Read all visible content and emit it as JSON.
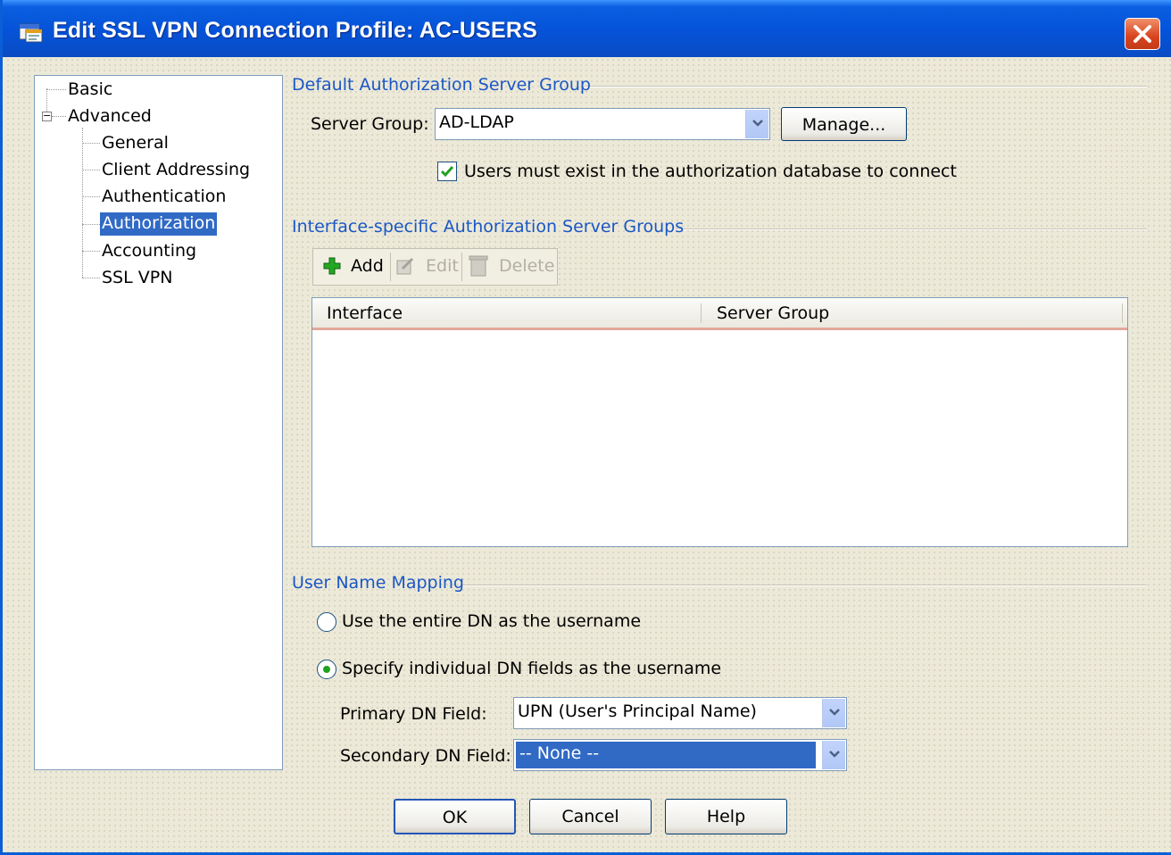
{
  "window": {
    "title": "Edit SSL VPN Connection Profile: AC-USERS"
  },
  "tree": {
    "basic": "Basic",
    "advanced": "Advanced",
    "expander": "−",
    "children": [
      "General",
      "Client Addressing",
      "Authentication",
      "Authorization",
      "Accounting",
      "SSL VPN"
    ],
    "selected": "Authorization"
  },
  "default_auth": {
    "section_title": "Default Authorization Server Group",
    "server_group_label": "Server Group:",
    "server_group_value": "AD-LDAP",
    "manage_label": "Manage...",
    "must_exist_label": "Users must exist in the authorization database to connect",
    "must_exist_checked": true
  },
  "interface_auth": {
    "section_title": "Interface-specific Authorization Server Groups",
    "toolbar": {
      "add": "Add",
      "edit": "Edit",
      "delete": "Delete"
    },
    "columns": [
      "Interface",
      "Server Group"
    ],
    "rows": []
  },
  "user_name_mapping": {
    "section_title": "User Name Mapping",
    "option_entire_dn": "Use the entire DN as the username",
    "option_individual": "Specify individual DN fields as the username",
    "selected_option": "individual",
    "primary_label": "Primary DN Field:",
    "primary_value": "UPN (User's Principal Name)",
    "secondary_label": "Secondary DN Field:",
    "secondary_value": "-- None --"
  },
  "buttons": {
    "ok": "OK",
    "cancel": "Cancel",
    "help": "Help"
  },
  "colors": {
    "titlebar": "#0552d8",
    "section_title": "#1a57c6",
    "selection": "#316ac5",
    "close_button": "#d8431e"
  }
}
